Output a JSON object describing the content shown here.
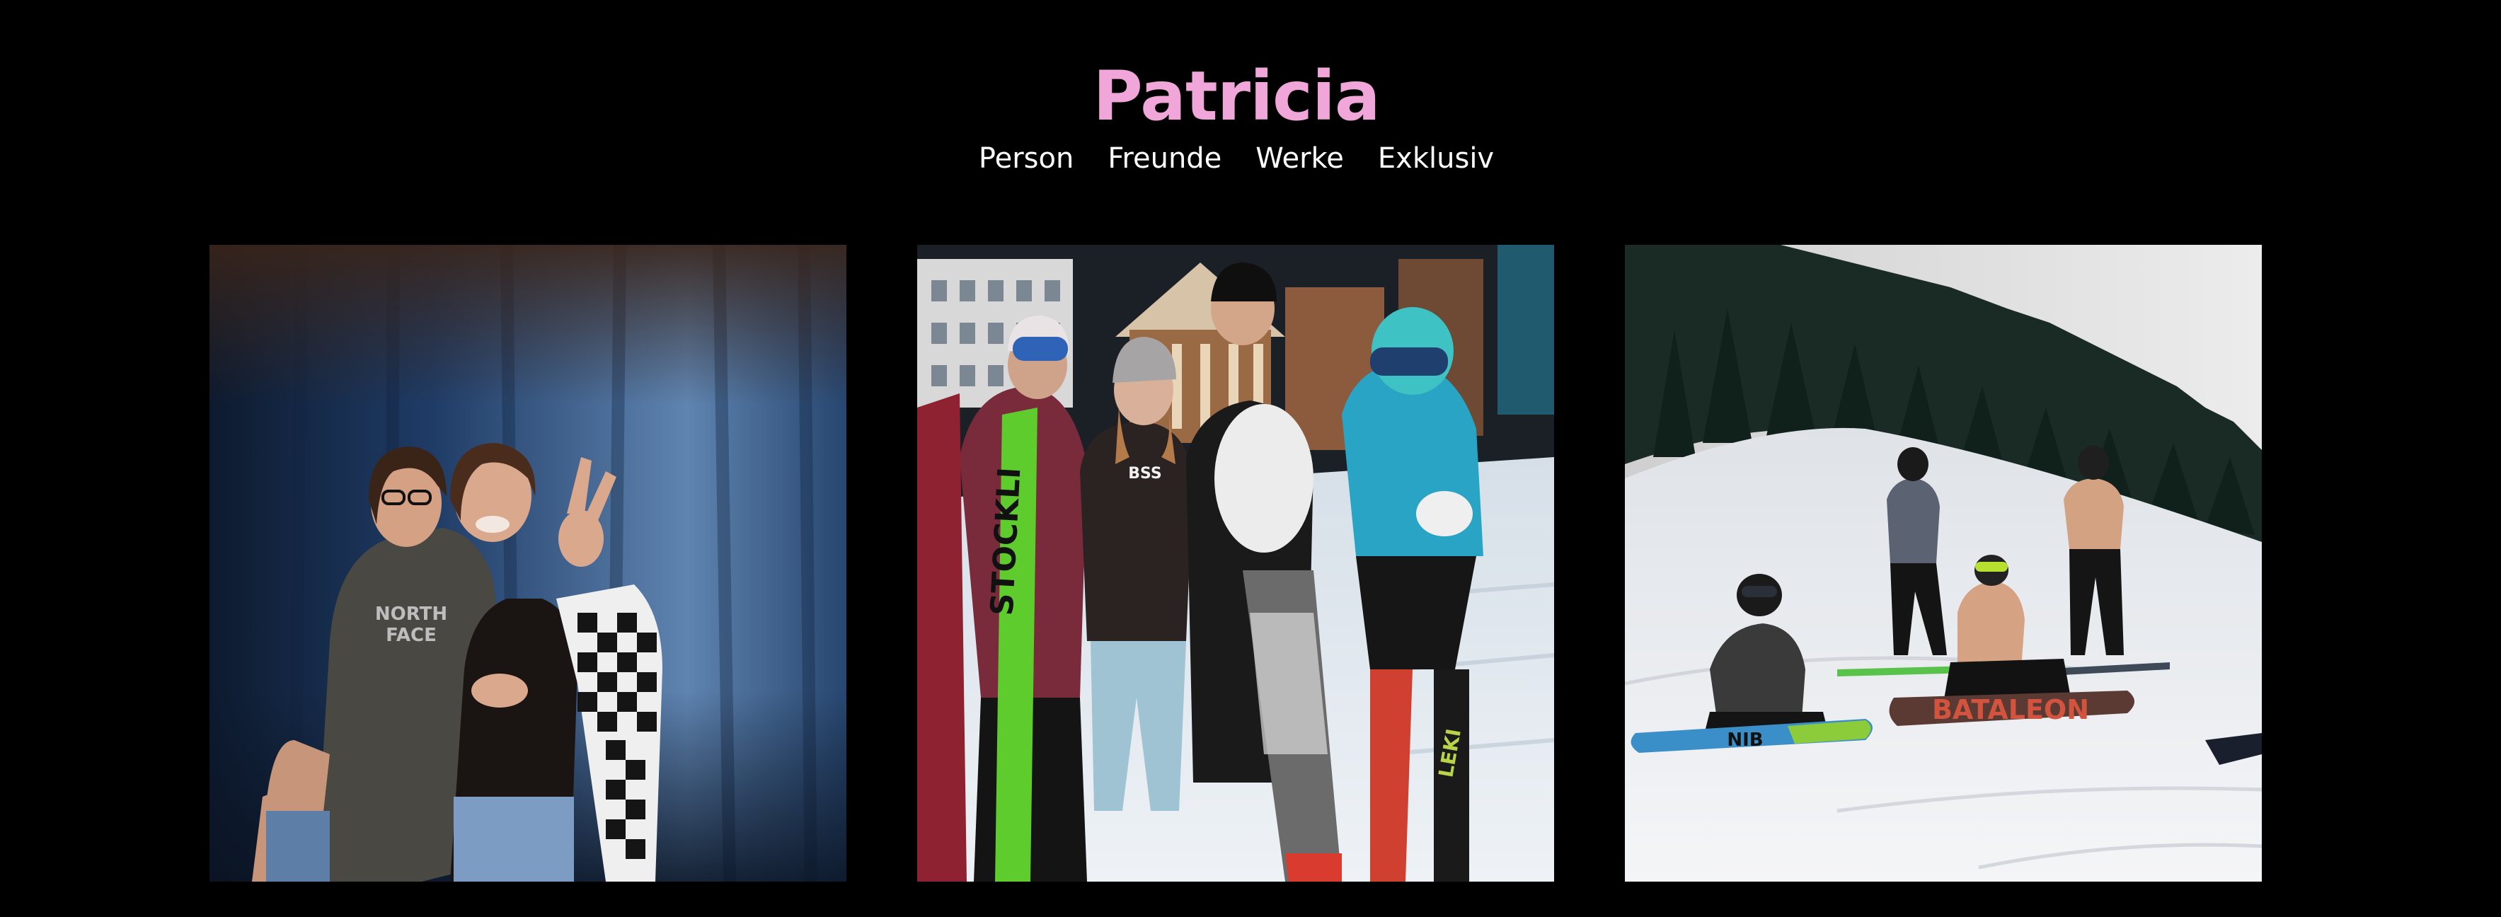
{
  "site": {
    "title": "Patricia",
    "title_color": "#f0a6d8",
    "background": "#000000"
  },
  "nav": {
    "items": [
      {
        "label": "Person"
      },
      {
        "label": "Freunde"
      },
      {
        "label": "Werke"
      },
      {
        "label": "Exklusiv"
      }
    ]
  },
  "gallery": {
    "photos": [
      {
        "subject": "two-friends-blue-curtain",
        "shirt_text": "NORTH FACE"
      },
      {
        "subject": "ski-group-village",
        "ski_text": "STOCKLI"
      },
      {
        "subject": "snowboarders-slope",
        "board_text": "BATALEON"
      }
    ]
  }
}
